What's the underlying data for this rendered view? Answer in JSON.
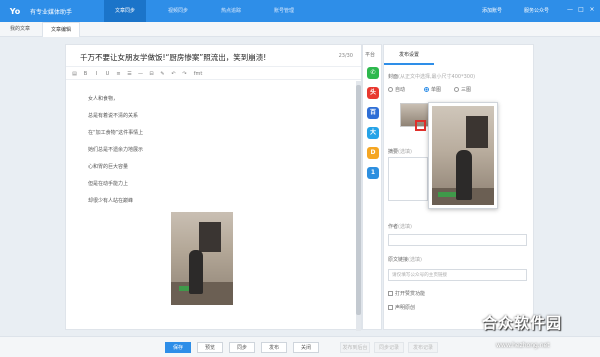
{
  "app": {
    "name": "有专业媒体助手",
    "logo_text": "Yo"
  },
  "nav": {
    "tabs": [
      "文章同步",
      "视频同步",
      "热点追踪",
      "账号管理"
    ],
    "active_index": 0
  },
  "top_right": {
    "share": "添加账号",
    "account": "服务公众号"
  },
  "window_buttons": [
    "—",
    "□",
    "×"
  ],
  "subtabs": [
    "我的文章",
    "文章编辑"
  ],
  "editor": {
    "title": "千万不要让女朋友学做饭!“厨房惨案”照流出，笑到崩溃!",
    "title_count": "23/30",
    "toolbar_icons": [
      "▤",
      "B",
      "I",
      "U",
      "≡",
      "☰",
      "—",
      "⊟",
      "✎",
      "↶",
      "↷",
      "fmt"
    ],
    "body": [
      "女人和食物，",
      "总是有着说不清的关系",
      "在“加工食物”这件事情上",
      "她们总是不遗余力地展示",
      "心和胃的巨大容量",
      "但是在动手能力上",
      "却很少有人站在巅峰"
    ]
  },
  "platforms": {
    "label": "平台",
    "icons": [
      {
        "name": "wechat-icon",
        "glyph": "✆",
        "color": "#2db84d"
      },
      {
        "name": "toutiao-icon",
        "glyph": "头",
        "color": "#e8382f"
      },
      {
        "name": "baijia-icon",
        "glyph": "百",
        "color": "#2f6fd6"
      },
      {
        "name": "dayu-icon",
        "glyph": "大",
        "color": "#26a3e8"
      },
      {
        "name": "yidian-icon",
        "glyph": "D",
        "color": "#f5a623"
      },
      {
        "name": "sohu-icon",
        "glyph": "1",
        "color": "#2d8fe0"
      }
    ]
  },
  "settings": {
    "tab": "发布设置",
    "cover_label": "封面",
    "cover_hint": "(从正文中选择,最小尺寸400*300)",
    "cover_options": [
      "自动",
      "单图",
      "三图"
    ],
    "cover_selected": 1,
    "summary_label": "摘要",
    "summary_hint": "(选填)",
    "author_label": "作者",
    "author_hint": "(选填)",
    "source_label": "原文链接",
    "source_hint": "(选填)",
    "source_placeholder": "请仅填写公众号的主页链接",
    "check_reward": "打开赞赏功能",
    "check_original": "声明原创"
  },
  "bottom": {
    "buttons": [
      "保存",
      "预览",
      "同步",
      "发布",
      "关闭"
    ],
    "disabled_buttons": [
      "发布到后台",
      "同步记录",
      "发布记录"
    ]
  },
  "watermark": {
    "text": "合众软件园",
    "url": "www.hezhong.net"
  },
  "colors": {
    "accent": "#2e8ee8",
    "selection_red": "#e0302b"
  }
}
